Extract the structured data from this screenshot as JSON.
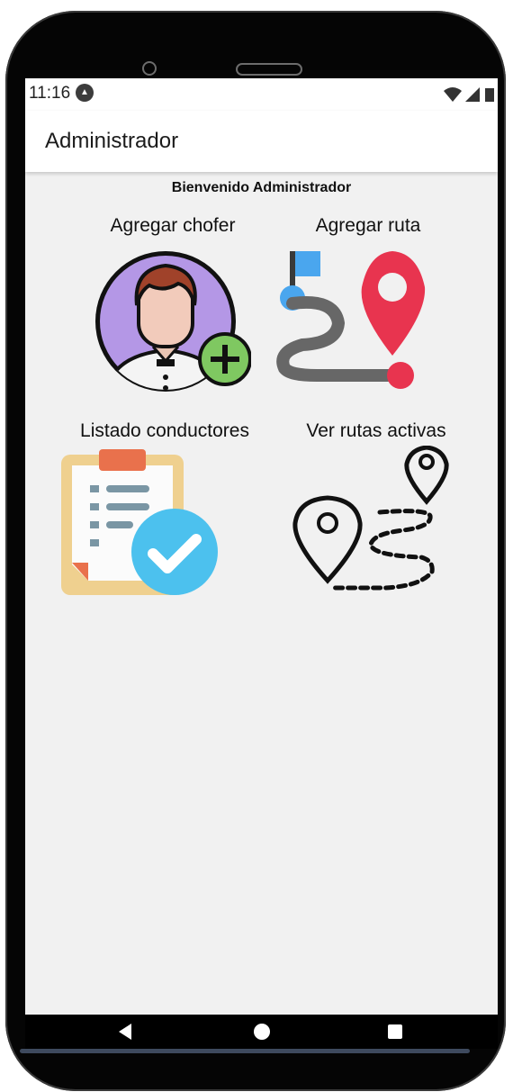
{
  "status_bar": {
    "time": "11:16",
    "notification_icon": "circle-a-icon",
    "icons": [
      "wifi-icon",
      "signal-icon",
      "battery-icon"
    ]
  },
  "app_bar": {
    "title": "Administrador"
  },
  "welcome": "Bienvenido Administrador",
  "tiles": [
    {
      "label": "Agregar chofer",
      "icon": "add-driver-icon"
    },
    {
      "label": "Agregar ruta",
      "icon": "route-pin-icon"
    },
    {
      "label": "Listado conductores",
      "icon": "clipboard-check-icon"
    },
    {
      "label": "Ver rutas activas",
      "icon": "active-routes-icon"
    }
  ],
  "nav_bar": {
    "buttons": [
      "back-icon",
      "home-icon",
      "recents-icon"
    ]
  },
  "colors": {
    "screen_bg": "#f1f1f1",
    "app_bar_bg": "#ffffff",
    "driver_circle": "#b497e6",
    "plus_badge": "#7fc861",
    "pin_red": "#e8344f",
    "flag_blue": "#4aa6ee",
    "route_gray": "#676767",
    "check_blue": "#4cc1ee",
    "clipboard": "#efd08f",
    "clip_orange": "#e9714c"
  }
}
